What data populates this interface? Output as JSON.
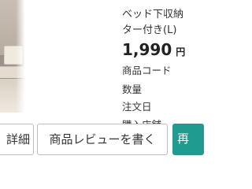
{
  "product": {
    "title_line1": "ベッド下収納",
    "title_line2": "ター付き(L)",
    "price": "1,990",
    "currency": "円"
  },
  "info_labels": {
    "product_code": "商品コード",
    "quantity": "数量",
    "order_date": "注文日",
    "store": "購入店舗"
  },
  "buttons": {
    "detail": "詳細",
    "review": "商品レビューを書く",
    "rebuy": "再"
  },
  "colors": {
    "accent": "#1f9c8f"
  }
}
